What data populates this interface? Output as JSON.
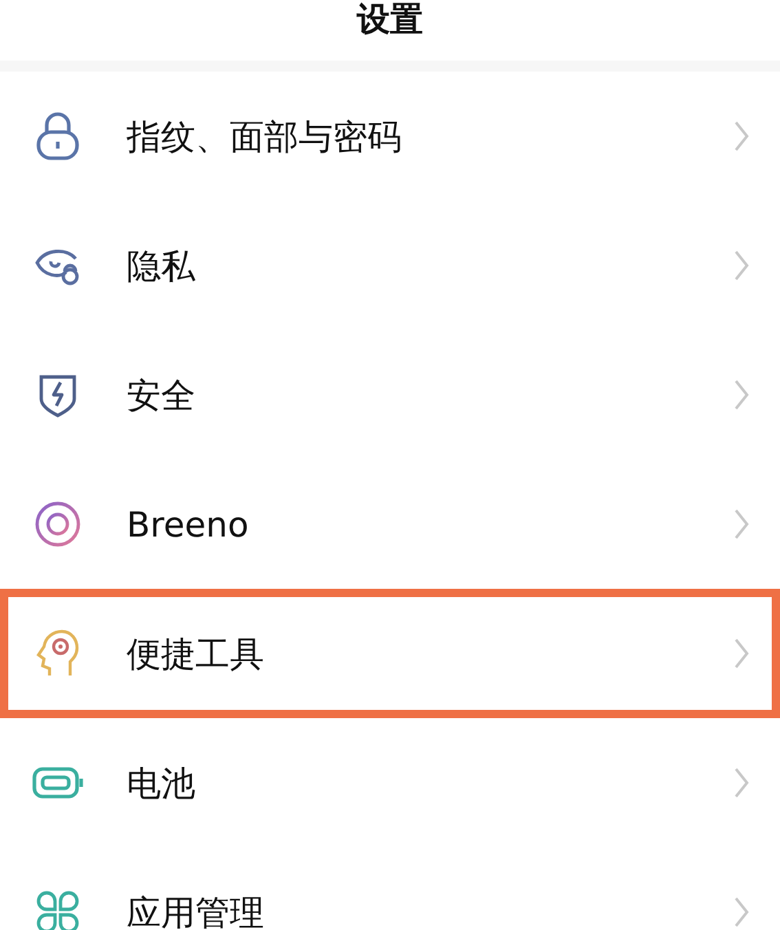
{
  "title": "设置",
  "items": [
    {
      "kind": "lock",
      "label": "指纹、面部与密码",
      "highlighted": false
    },
    {
      "kind": "eye",
      "label": "隐私",
      "highlighted": false
    },
    {
      "kind": "shield",
      "label": "安全",
      "highlighted": false
    },
    {
      "kind": "ring",
      "label": "Breeno",
      "highlighted": false
    },
    {
      "kind": "head",
      "label": "便捷工具",
      "highlighted": true
    },
    {
      "kind": "battery",
      "label": "电池",
      "highlighted": false
    },
    {
      "kind": "apps",
      "label": "应用管理",
      "highlighted": false
    }
  ]
}
